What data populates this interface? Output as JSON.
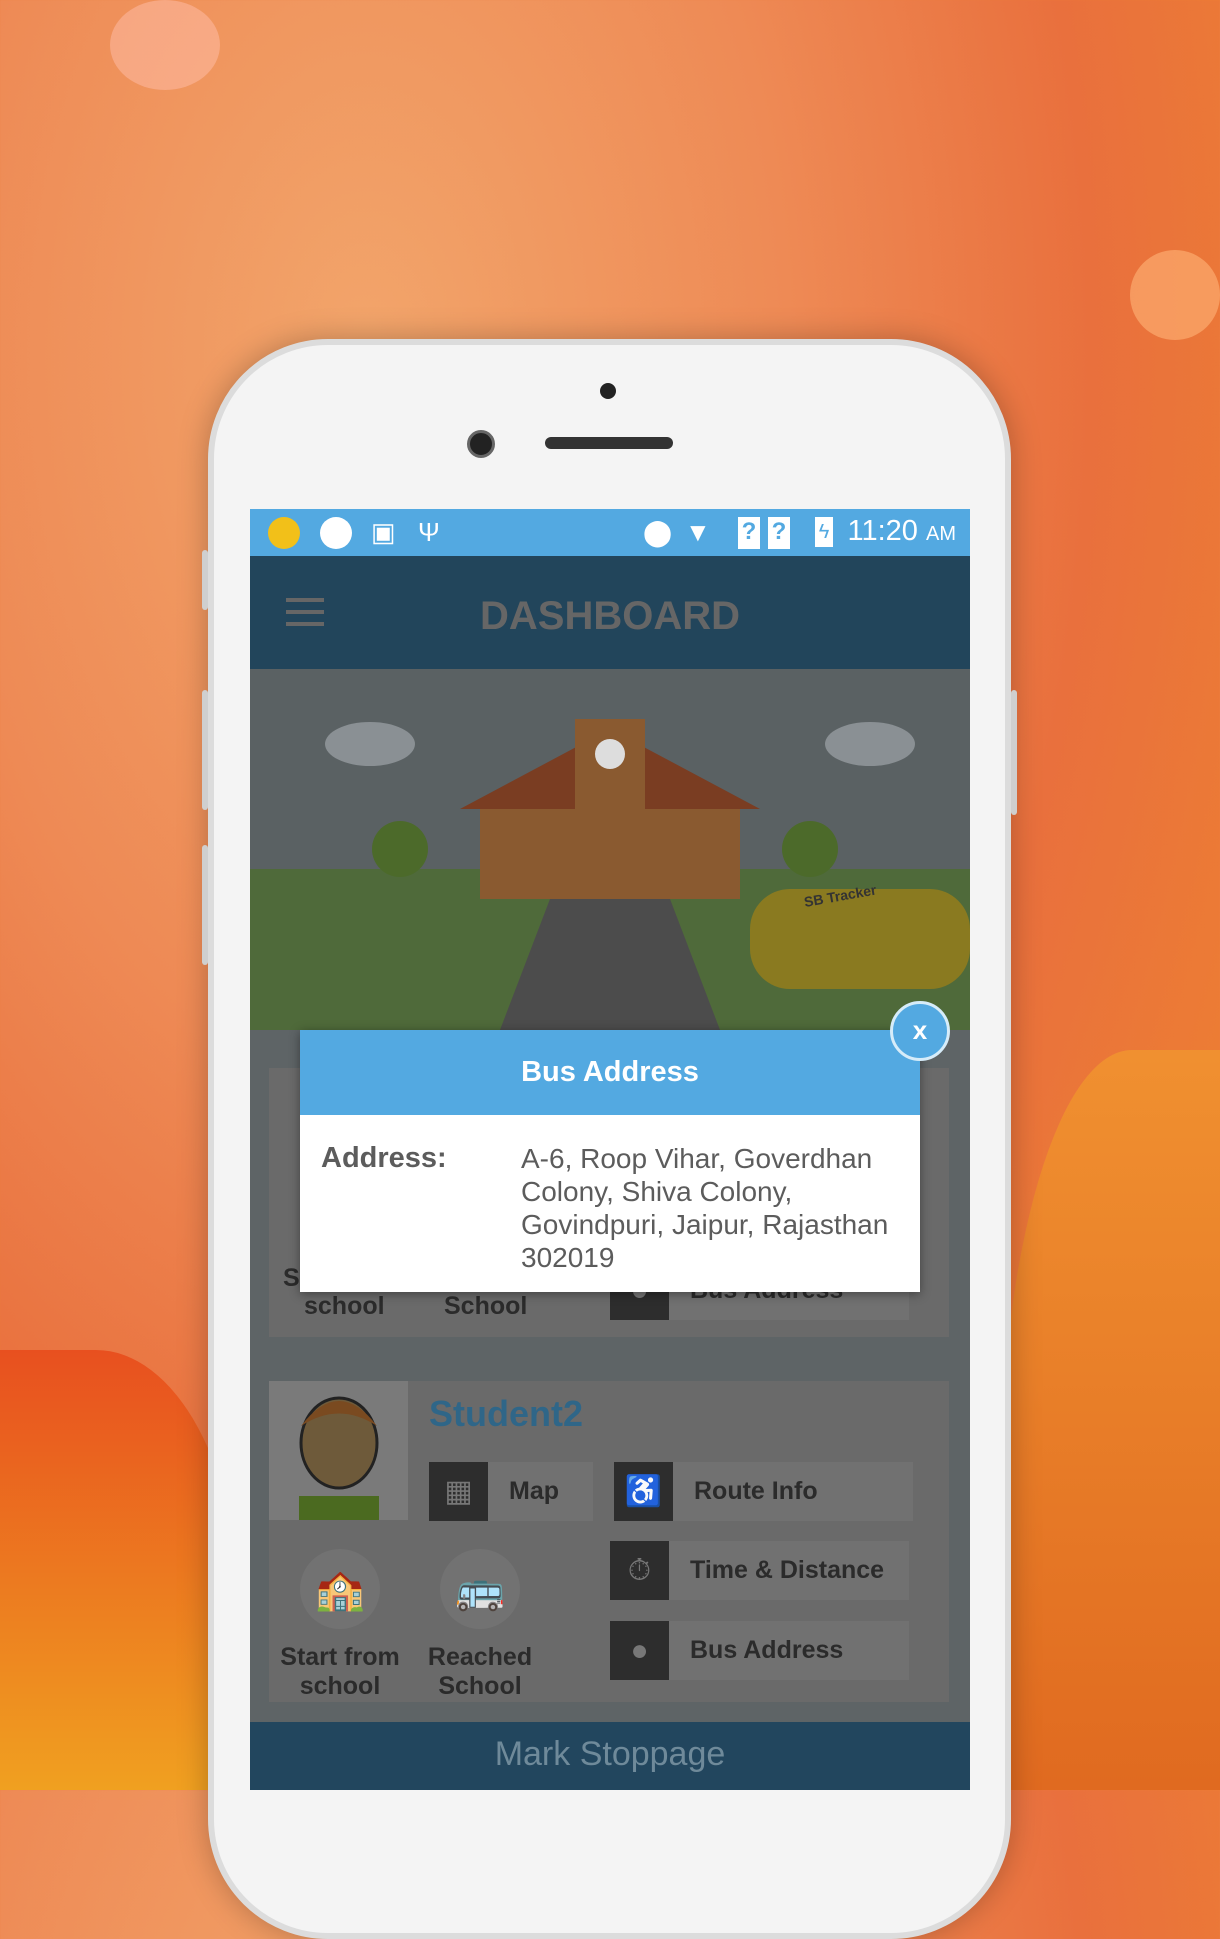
{
  "status_bar": {
    "time": "11:20",
    "ampm": "AM",
    "icons": [
      "thermometer-notification-icon",
      "circle-icon",
      "android-icon",
      "usb-icon",
      "location-icon",
      "wifi-icon",
      "sim-unknown-icon",
      "sim-unknown-icon",
      "battery-charging-icon"
    ]
  },
  "header": {
    "title": "DASHBOARD",
    "menu_icon": "hamburger-icon"
  },
  "banner": {
    "bus_label": "SB Tracker"
  },
  "student1": {
    "partial_letter": "S",
    "start_label": "school",
    "reached_label": "School",
    "bus_address": "Bus Address"
  },
  "student2": {
    "name": "Student2",
    "buttons": {
      "map": "Map",
      "route_info": "Route Info",
      "time_distance": "Time & Distance",
      "bus_address": "Bus Address"
    },
    "start_from_school": "Start from school",
    "reached_school": "Reached School"
  },
  "footer": {
    "mark_stoppage": "Mark Stoppage"
  },
  "modal": {
    "title": "Bus Address",
    "address_label": "Address:",
    "address_value": "A-6, Roop Vihar, Goverdhan Colony, Shiva Colony, Govindpuri, Jaipur, Rajasthan 302019",
    "close": "x"
  },
  "colors": {
    "status_bar": "#53a9e1",
    "header": "#22455b",
    "modal_header": "#53a9e1",
    "student_name": "#2f6688"
  }
}
